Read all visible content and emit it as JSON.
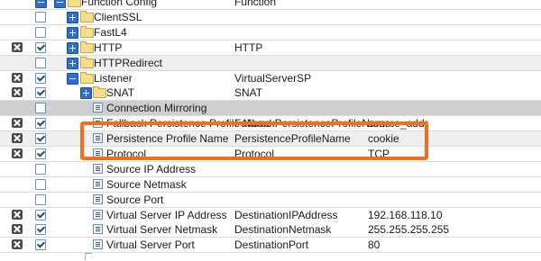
{
  "colors": {
    "highlight": "#f0701e",
    "toggle": "#2d6fd0",
    "folder": "#f6df8a",
    "grey_row": "#cfcfcf"
  },
  "rows": [
    {
      "icon": "folder-icon",
      "toggle": "minus",
      "indent": 1,
      "x_mark": false,
      "checkbox": "none",
      "name": "Function Config",
      "col2": "Function",
      "col3": "",
      "shade": "white"
    },
    {
      "icon": "folder-icon",
      "toggle": "plus",
      "indent": 2,
      "x_mark": false,
      "checkbox": "unchecked",
      "name": "ClientSSL",
      "col2": "",
      "col3": "",
      "shade": "white"
    },
    {
      "icon": "folder-icon",
      "toggle": "plus",
      "indent": 2,
      "x_mark": false,
      "checkbox": "unchecked",
      "name": "FastL4",
      "col2": "",
      "col3": "",
      "shade": "white"
    },
    {
      "icon": "folder-icon",
      "toggle": "plus",
      "indent": 2,
      "x_mark": true,
      "checkbox": "checked",
      "name": "HTTP",
      "col2": "HTTP",
      "col3": "",
      "shade": "white"
    },
    {
      "icon": "folder-icon",
      "toggle": "plus",
      "indent": 2,
      "x_mark": false,
      "checkbox": "unchecked",
      "name": "HTTPRedirect",
      "col2": "",
      "col3": "",
      "shade": "alt"
    },
    {
      "icon": "folder-icon",
      "toggle": "minus",
      "indent": 2,
      "x_mark": true,
      "checkbox": "checked",
      "name": "Listener",
      "col2": "VirtualServerSP",
      "col3": "",
      "shade": "white"
    },
    {
      "icon": "folder-icon",
      "toggle": "plus",
      "indent": 3,
      "x_mark": true,
      "checkbox": "checked",
      "name": "SNAT",
      "col2": "SNAT",
      "col3": "",
      "shade": "white"
    },
    {
      "icon": "property-icon",
      "toggle": "none",
      "indent": 3,
      "x_mark": false,
      "checkbox": "unchecked",
      "name": "Connection Mirroring",
      "col2": "",
      "col3": "",
      "shade": "grey"
    },
    {
      "icon": "property-icon",
      "toggle": "none",
      "indent": 3,
      "x_mark": true,
      "checkbox": "checked",
      "name": "Fallback Persistence Profile Name",
      "col2": "FallbackPersistenceProfileName",
      "col3": "source_addr",
      "shade": "white"
    },
    {
      "icon": "property-icon",
      "toggle": "none",
      "indent": 3,
      "x_mark": true,
      "checkbox": "checked",
      "name": "Persistence Profile Name",
      "col2": "PersistenceProfileName",
      "col3": "cookie",
      "shade": "alt"
    },
    {
      "icon": "property-icon",
      "toggle": "none",
      "indent": 3,
      "x_mark": true,
      "checkbox": "checked",
      "name": "Protocol",
      "col2": "Protocol",
      "col3": "TCP",
      "shade": "white"
    },
    {
      "icon": "property-icon",
      "toggle": "none",
      "indent": 3,
      "x_mark": false,
      "checkbox": "unchecked",
      "name": "Source IP Address",
      "col2": "",
      "col3": "",
      "shade": "white"
    },
    {
      "icon": "property-icon",
      "toggle": "none",
      "indent": 3,
      "x_mark": false,
      "checkbox": "unchecked",
      "name": "Source Netmask",
      "col2": "",
      "col3": "",
      "shade": "white"
    },
    {
      "icon": "property-icon",
      "toggle": "none",
      "indent": 3,
      "x_mark": false,
      "checkbox": "unchecked",
      "name": "Source Port",
      "col2": "",
      "col3": "",
      "shade": "white"
    },
    {
      "icon": "property-icon",
      "toggle": "none",
      "indent": 3,
      "x_mark": true,
      "checkbox": "checked",
      "name": "Virtual Server IP Address",
      "col2": "DestinationIPAddress",
      "col3": "192.168.118.10",
      "shade": "white"
    },
    {
      "icon": "property-icon",
      "toggle": "none",
      "indent": 3,
      "x_mark": true,
      "checkbox": "checked",
      "name": "Virtual Server Netmask",
      "col2": "DestinationNetmask",
      "col3": "255.255.255.255",
      "shade": "white"
    },
    {
      "icon": "property-icon",
      "toggle": "none",
      "indent": 3,
      "x_mark": true,
      "checkbox": "checked",
      "name": "Virtual Server Port",
      "col2": "DestinationPort",
      "col3": "80",
      "shade": "white"
    }
  ]
}
